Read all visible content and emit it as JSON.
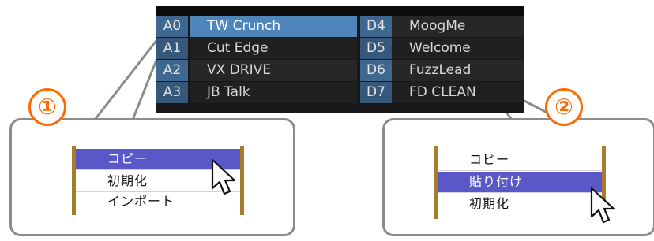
{
  "presets": {
    "left": [
      {
        "id": "A0",
        "name": "TW Crunch",
        "selected": true
      },
      {
        "id": "A1",
        "name": "Cut Edge",
        "selected": false
      },
      {
        "id": "A2",
        "name": "VX DRIVE",
        "selected": false
      },
      {
        "id": "A3",
        "name": "JB Talk",
        "selected": false
      }
    ],
    "right": [
      {
        "id": "D4",
        "name": "MoogMe"
      },
      {
        "id": "D5",
        "name": "Welcome"
      },
      {
        "id": "D6",
        "name": "FuzzLead"
      },
      {
        "id": "D7",
        "name": "FD CLEAN"
      }
    ]
  },
  "steps": {
    "step1": "①",
    "step2": "②"
  },
  "menu1": {
    "items": [
      "コピー",
      "初期化",
      "インポート"
    ],
    "highlighted": "コピー"
  },
  "menu2": {
    "items": [
      "コピー",
      "貼り付け",
      "初期化"
    ],
    "highlighted": "貼り付け"
  },
  "colors": {
    "accent": "#ff6a00",
    "menu_highlight": "#5a57c8",
    "selected_row": "#4e86bb"
  },
  "icons": [
    "mouse-pointer-icon"
  ]
}
